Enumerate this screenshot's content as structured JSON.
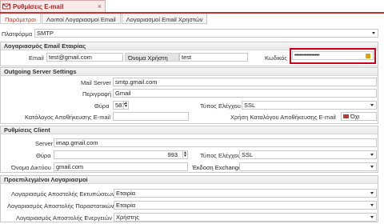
{
  "window_tab": {
    "title": "Ρυθμίσεις E-mail",
    "close": "×"
  },
  "subtabs": [
    "Παράμετροι",
    "Λοιποί Λογαριασμοί Email",
    "Λογαριασμοί Email Χρηστών"
  ],
  "platform": {
    "label": "Πλατφόρμα",
    "value": "SMTP"
  },
  "company_account": {
    "header": "Λογαριασμός Email Εταιρίας",
    "email_label": "Email",
    "email_value": "test@gmail.com",
    "username_label": "Όνομα Χρήστη",
    "username_value": "test",
    "password_label": "Κωδικός",
    "password_value": "••••••••••••••••"
  },
  "outgoing": {
    "header": "Outgoing Server Settings",
    "mail_server_label": "Mail Server",
    "mail_server_value": "smtp.gmail.com",
    "description_label": "Περιγραφή",
    "description_value": "Gmail",
    "port_label": "Θύρα",
    "port_value": "587",
    "check_type_label": "Τύπος Ελέγχου",
    "check_type_value": "SSL",
    "save_folder_label": "Κατάλογος Αποθήκευσης E-mail",
    "save_folder_value": "",
    "user_folder_label": "Χρήση Καταλόγου Αποθήκευσης E-mail",
    "user_folder_value": "Όχι"
  },
  "client": {
    "header": "Ρυθμίσεις Client",
    "server_label": "Server",
    "server_value": "imap.gmail.com",
    "port_label": "Θύρα",
    "port_value": "993",
    "check_type_label": "Τύπος Ελέγχου",
    "check_type_value": "SSL",
    "network_name_label": "Όνομα Δικτύου",
    "network_name_value": "gmail.com",
    "exchange_label": "Έκδοση Exchange",
    "exchange_value": ""
  },
  "defaults": {
    "header": "Προεπιλεγμένοι Λογαριασμοί",
    "print_label": "Λογαριασμός Αποστολής Εκτυπώσεων",
    "print_value": "Εταιρία",
    "docs_label": "Λογαριασμός Αποστολής Παραστατικών",
    "docs_value": "Εταιρία",
    "actions_label": "Λογαριασμός Αποστολής Ενεργειών",
    "actions_value": "Χρήστης"
  },
  "colors": {
    "accent": "#c9302c",
    "highlight": "#d0021b"
  }
}
